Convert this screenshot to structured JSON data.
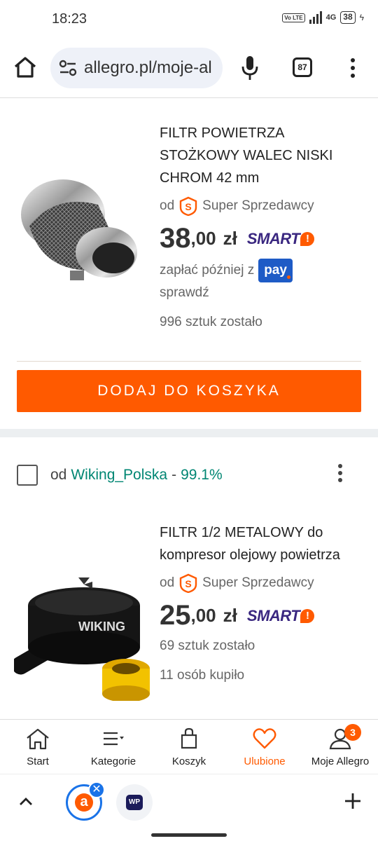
{
  "status_bar": {
    "time": "18:23",
    "volte": "Vo LTE",
    "network": "4G",
    "battery": "38"
  },
  "browser": {
    "url": "allegro.pl/moje-al",
    "tab_count": "87"
  },
  "products": [
    {
      "title": "FILTR POWIETRZA STOŻKOWY WALEC NISKI CHROM 42 mm",
      "seller_prefix": "od",
      "seller_label": "Super Sprzedawcy",
      "price_whole": "38",
      "price_decimal": ",00",
      "currency": "zł",
      "smart_label": "SMART",
      "pay_later": "zapłać później z",
      "pay_brand": "pay",
      "check": "sprawdź",
      "stock": "996 sztuk zostało",
      "add_to_cart": "DODAJ DO KOSZYKA"
    },
    {
      "title": "FILTR 1/2 METALOWY do kompresor olejowy powietrza",
      "seller_prefix": "od",
      "seller_label": "Super Sprzedawcy",
      "price_whole": "25",
      "price_decimal": ",00",
      "currency": "zł",
      "smart_label": "SMART",
      "stock": "69 sztuk zostało",
      "bought": "11 osób kupiło",
      "image_brand": "WIKING"
    }
  ],
  "seller_group": {
    "prefix": "od",
    "name": "Wiking_Polska",
    "dash": "-",
    "rating": "99.1%"
  },
  "bottom_nav": [
    {
      "label": "Start",
      "icon": "home-icon"
    },
    {
      "label": "Kategorie",
      "icon": "categories-icon"
    },
    {
      "label": "Koszyk",
      "icon": "cart-icon"
    },
    {
      "label": "Ulubione",
      "icon": "heart-icon",
      "active": true
    },
    {
      "label": "Moje Allegro",
      "icon": "user-icon",
      "badge": "3"
    }
  ],
  "tab_strip": {
    "allegro_letter": "a",
    "close_glyph": "✕",
    "wp_label": "WP"
  },
  "colors": {
    "accent": "#ff5a00",
    "seller_green": "#008673",
    "smart_purple": "#3a2780",
    "pay_blue": "#1e5bc6"
  }
}
